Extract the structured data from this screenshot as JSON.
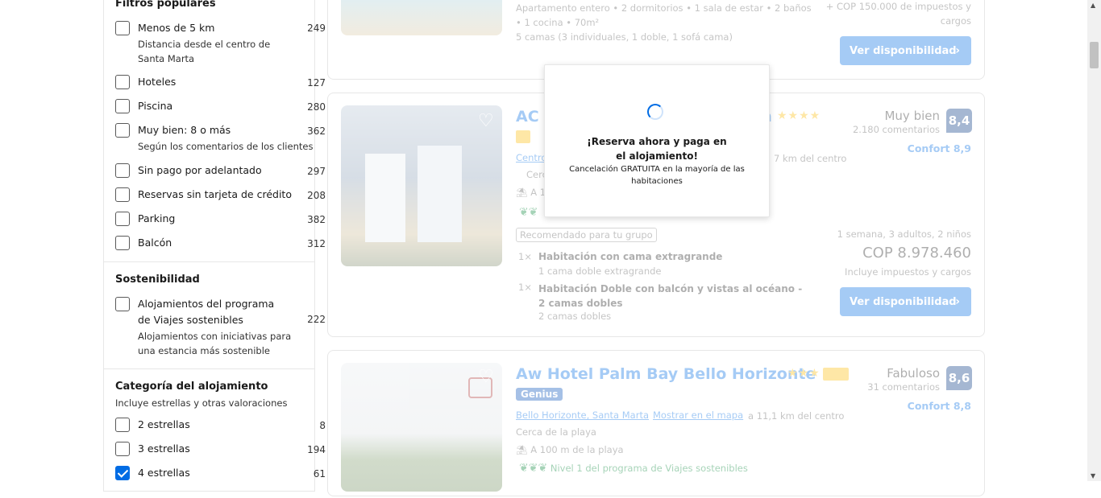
{
  "sidebar": {
    "popular": {
      "title": "Filtros populares",
      "items": [
        {
          "label": "Menos de 5 km",
          "count": "249",
          "sub": "Distancia desde el centro de Santa Marta"
        },
        {
          "label": "Hoteles",
          "count": "127"
        },
        {
          "label": "Piscina",
          "count": "280"
        },
        {
          "label": "Muy bien: 8 o más",
          "count": "362",
          "sub": "Según los comentarios de los clientes"
        },
        {
          "label": "Sin pago por adelantado",
          "count": "297"
        },
        {
          "label": "Reservas sin tarjeta de crédito",
          "count": "208"
        },
        {
          "label": "Parking",
          "count": "382"
        },
        {
          "label": "Balcón",
          "count": "312"
        }
      ]
    },
    "sustainability": {
      "title": "Sostenibilidad",
      "items": [
        {
          "label": "Alojamientos del programa de Viajes sostenibles",
          "count": "222",
          "sub": "Alojamientos con iniciativas para una estancia más sostenible"
        }
      ]
    },
    "category": {
      "title": "Categoría del alojamiento",
      "subtitle": "Incluye estrellas y otras valoraciones",
      "items": [
        {
          "label": "2 estrellas",
          "count": "8",
          "checked": false
        },
        {
          "label": "3 estrellas",
          "count": "194",
          "checked": false
        },
        {
          "label": "4 estrellas",
          "count": "61",
          "checked": true
        }
      ]
    }
  },
  "card0": {
    "details1": "Apartamento entero • 2 dormitorios • 1 sala de estar • 2 baños",
    "details2": "• 1 cocina • 70m²",
    "beds": "5 camas (3 individuales, 1 doble, 1 sofá cama)",
    "tax1": "+ COP 150.000 de impuestos y",
    "tax2": "cargos",
    "button": "Ver disponibilidad"
  },
  "card1": {
    "title": "AC Hotel",
    "title_end": "a",
    "stars": "★★★★",
    "location": "Centro",
    "distance": "7 km del centro",
    "near": "Cerca",
    "beach": "A 1",
    "rating_word": "Muy bien",
    "reviews": "2.180 comentarios",
    "score": "8,4",
    "comfort": "Confort 8,9",
    "recommended": "Recomendado para tu grupo",
    "stay": "1 semana, 3 adultos, 2 niños",
    "price": "COP 8.978.460",
    "taxes": "Incluye impuestos y cargos",
    "room1_qty": "1×",
    "room1": "Habitación con cama extragrande",
    "room1_bed": "1 cama doble extragrande",
    "room2_qty": "1×",
    "room2": "Habitación Doble con balcón y vistas al océano - 2 camas dobles",
    "room2_bed": "2 camas dobles",
    "button": "Ver disponibilidad"
  },
  "card2": {
    "title": "Aw Hotel Palm Bay Bello Horizonte",
    "stars": "★★★",
    "genius": "Genius",
    "location": "Bello Horizonte, Santa Marta",
    "map": "Mostrar en el mapa",
    "distance": "a 11,1 km del centro",
    "near": "Cerca de la playa",
    "beach": "A 100 m de la playa",
    "sustain": "Nivel 1 del programa de Viajes sostenibles",
    "rating_word": "Fabuloso",
    "reviews": "31 comentarios",
    "score": "8,6",
    "comfort": "Confort 8,8"
  },
  "modal": {
    "title": "¡Reserva ahora y paga en el alojamiento!",
    "text": "Cancelación GRATUITA en la mayoría de las habitaciones"
  }
}
